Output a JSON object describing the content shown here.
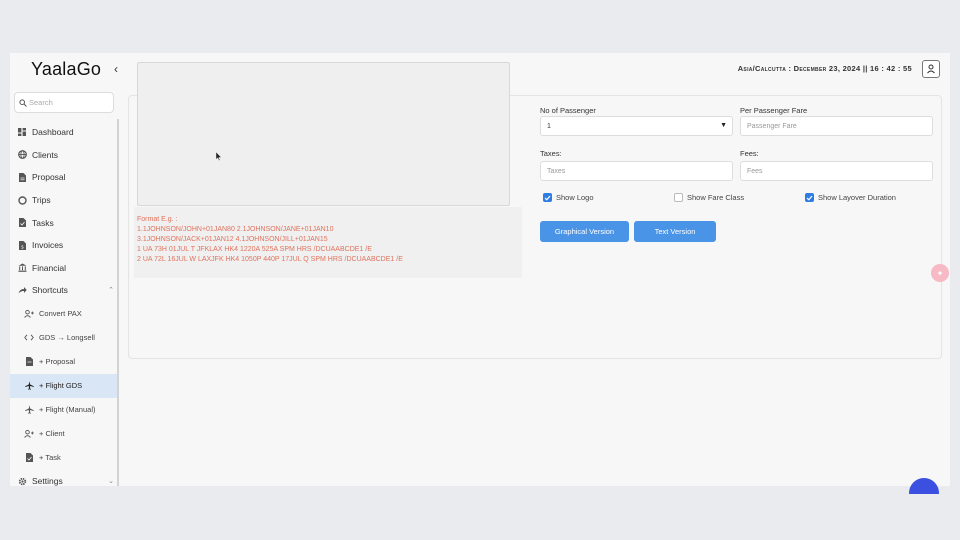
{
  "app": {
    "logo": "YaalaGo",
    "collapse_icon": "chevron-left-icon",
    "clock": "Asia/Calcutta : December 23, 2024 || 16 : 42 : 55"
  },
  "search": {
    "placeholder": "Search"
  },
  "sidebar": {
    "items": [
      {
        "label": "Dashboard",
        "icon": "dashboard-icon"
      },
      {
        "label": "Clients",
        "icon": "globe-icon"
      },
      {
        "label": "Proposal",
        "icon": "document-icon"
      },
      {
        "label": "Trips",
        "icon": "circle-icon"
      },
      {
        "label": "Tasks",
        "icon": "task-icon"
      },
      {
        "label": "Invoices",
        "icon": "invoice-icon"
      },
      {
        "label": "Financial",
        "icon": "bank-icon"
      },
      {
        "label": "Shortcuts",
        "icon": "share-icon"
      }
    ],
    "shortcuts": [
      {
        "label": "Convert PAX",
        "icon": "user-add-icon"
      },
      {
        "label": "GDS → Longsell",
        "icon": "code-icon"
      },
      {
        "label": "+ Proposal",
        "icon": "document-icon"
      },
      {
        "label": "+ Flight GDS",
        "icon": "plane-icon",
        "active": true
      },
      {
        "label": "+ Flight (Manual)",
        "icon": "plane-icon"
      },
      {
        "label": "+ Client",
        "icon": "user-add-icon"
      },
      {
        "label": "+ Task",
        "icon": "task-icon"
      }
    ],
    "settings": {
      "label": "Settings",
      "icon": "gear-icon"
    }
  },
  "format": {
    "title": "Format E.g. :",
    "lines": [
      "1.1JOHNSON/JOHN+01JAN80 2.1JOHNSON/JANE+01JAN10",
      "3.1JOHNSON/JACK+01JAN12 4.1JOHNSON/JILL+01JAN15",
      "1 UA 73H 01JUL T JFKLAX HK4 1220A 525A SPM HRS /DCUAABCDE1 /E",
      "2 UA 72L 16JUL W LAXJFK HK4 1050P 440P 17JUL Q SPM HRS /DCUAABCDE1 /E"
    ]
  },
  "form": {
    "passengers_label": "No of Passenger",
    "passengers_value": "1",
    "fare_label": "Per Passenger Fare",
    "fare_placeholder": "Passenger Fare",
    "taxes_label": "Taxes:",
    "taxes_placeholder": "Taxes",
    "fees_label": "Fees:",
    "fees_placeholder": "Fees",
    "show_logo": "Show Logo",
    "show_logo_checked": true,
    "show_fare_class": "Show Fare Class",
    "show_fare_class_checked": false,
    "show_layover": "Show Layover Duration",
    "show_layover_checked": true,
    "graphical_btn": "Graphical Version",
    "text_btn": "Text Version"
  },
  "colors": {
    "accent": "#4a94e8",
    "format_text": "#e0735d",
    "active_nav": "#d9e6f5"
  }
}
